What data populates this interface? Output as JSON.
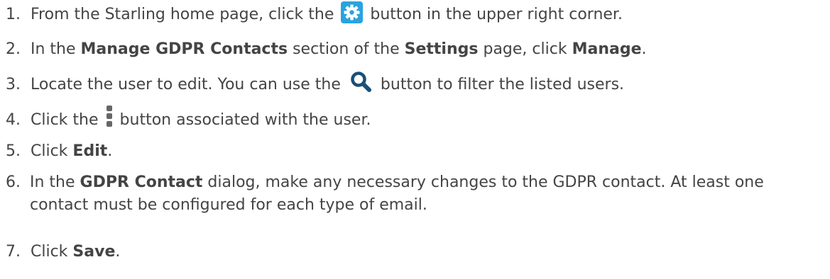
{
  "steps": [
    {
      "num": "1.",
      "before": "From the Starling home page, click the",
      "icon": "gear-icon",
      "after": "button in the upper right corner."
    },
    {
      "num": "2.",
      "t1": "In the",
      "b1": "Manage GDPR Contacts",
      "t2": "section of the",
      "b2": "Settings",
      "t3": "page, click",
      "b3": "Manage",
      "t4": "."
    },
    {
      "num": "3.",
      "before": "Locate the user to edit. You can use the",
      "icon": "search-icon",
      "after": "button to filter the listed users."
    },
    {
      "num": "4.",
      "before": "Click the",
      "icon": "kebab-menu-icon",
      "after": "button associated with the user."
    },
    {
      "num": "5.",
      "t1": "Click",
      "b1": "Edit",
      "t2": "."
    },
    {
      "num": "6.",
      "t1": "In the",
      "b1": "GDPR Contact",
      "t2": "dialog, make any necessary changes to the GDPR contact. At least one contact must be configured for each type of email."
    },
    {
      "num": "7.",
      "t1": "Click",
      "b1": "Save",
      "t2": "."
    }
  ],
  "colors": {
    "text": "#444444",
    "gear_icon_bg": "#29a3e0",
    "search_icon": "#1a4f78",
    "kebab_icon": "#666666"
  }
}
